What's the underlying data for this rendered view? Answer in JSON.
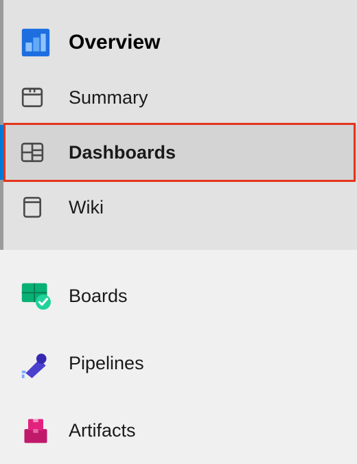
{
  "sidebar": {
    "overview_label": "Overview",
    "summary_label": "Summary",
    "dashboards_label": "Dashboards",
    "wiki_label": "Wiki",
    "boards_label": "Boards",
    "pipelines_label": "Pipelines",
    "artifacts_label": "Artifacts"
  },
  "colors": {
    "overview_accent": "#1d6fe0",
    "boards_accent": "#08b074",
    "pipelines_accent": "#4b3fcf",
    "artifacts_accent": "#e2237d",
    "highlight": "#e5331b"
  }
}
